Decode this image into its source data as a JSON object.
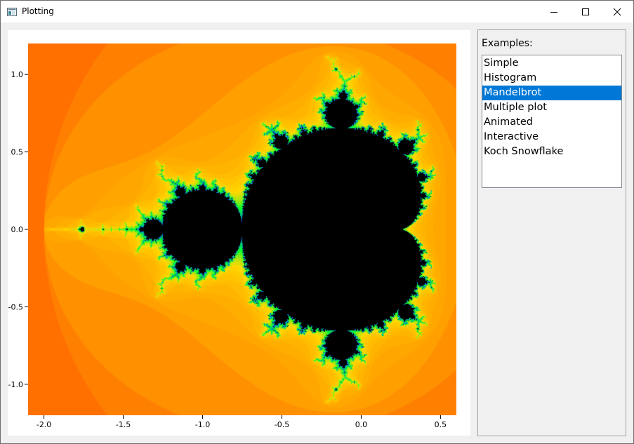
{
  "window": {
    "title": "Plotting"
  },
  "side_panel": {
    "label": "Examples:",
    "items": [
      "Simple",
      "Histogram",
      "Mandelbrot",
      "Multiple plot",
      "Animated",
      "Interactive",
      "Koch Snowflake"
    ],
    "selected_index": 2
  },
  "colors": {
    "selection": "#0078d7",
    "fractal_outer": "#ff6000",
    "fractal_mid": "#ffa000",
    "fractal_edge": "#ffd800",
    "fractal_fringe": "#00ff30",
    "fractal_inside": "#000000"
  },
  "icons": {
    "app": "app-window-icon",
    "minimize": "minimize-icon",
    "maximize": "maximize-icon",
    "close": "close-icon"
  },
  "chart_data": {
    "type": "heatmap",
    "title": "",
    "xlabel": "",
    "ylabel": "",
    "xlim": [
      -2.1,
      0.6
    ],
    "ylim": [
      -1.2,
      1.2
    ],
    "x_ticks": [
      -2.0,
      -1.5,
      -1.0,
      -0.5,
      0.0,
      0.5
    ],
    "x_tick_labels": [
      "-2.0",
      "-1.5",
      "-1.0",
      "-0.5",
      "0.0",
      "0.5"
    ],
    "y_ticks": [
      1.0,
      0.5,
      0.0,
      -0.5,
      -1.0
    ],
    "y_tick_labels": [
      "1.0",
      "0.5",
      "0.0",
      "-0.5",
      "-1.0"
    ],
    "grid": false,
    "max_iterations": 60
  }
}
